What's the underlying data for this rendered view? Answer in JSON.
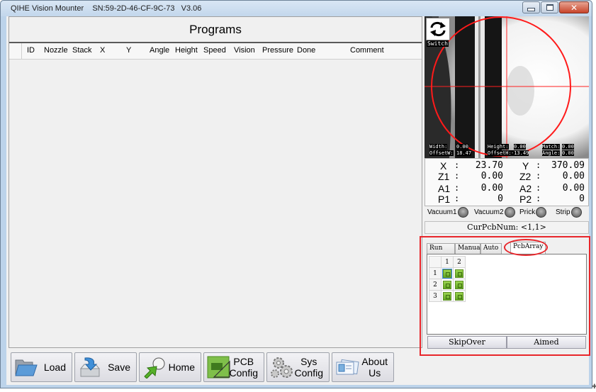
{
  "window": {
    "title": "QIHE Vision Mounter    SN:59-2D-46-CF-9C-73   V3.06",
    "controls": {
      "minimize": "minimize",
      "maximize": "maximize",
      "close": "close"
    }
  },
  "programs": {
    "title": "Programs",
    "columns": [
      "ID",
      "Nozzle",
      "Stack",
      "X",
      "Y",
      "Angle",
      "Height",
      "Speed",
      "Vision",
      "Pressure",
      "Done",
      "Comment"
    ],
    "rows": []
  },
  "camera": {
    "switch_label": "Switch",
    "readouts": {
      "width_label": "Width:",
      "width_value": "0.00",
      "height_label": "Height:",
      "height_value": "0.00",
      "match_label": "Match:",
      "match_value": "0.00",
      "offsetw_label": "OffsetW:",
      "offsetw_value": "18.47",
      "offseth_label": "OffsetH:",
      "offseth_value": "-13.49",
      "angle_label": "Angle:",
      "angle_value": "0.00"
    }
  },
  "coordinates": {
    "x": {
      "label": "X",
      "value": "23.70"
    },
    "y": {
      "label": "Y",
      "value": "370.09"
    },
    "z1": {
      "label": "Z1",
      "value": "0.00"
    },
    "z2": {
      "label": "Z2",
      "value": "0.00"
    },
    "a1": {
      "label": "A1",
      "value": "0.00"
    },
    "a2": {
      "label": "A2",
      "value": "0.00"
    },
    "p1": {
      "label": "P1",
      "value": "0"
    },
    "p2": {
      "label": "P2",
      "value": "0"
    },
    "colon": ":"
  },
  "indicators": [
    {
      "label": "Vacuum1",
      "state": "off"
    },
    {
      "label": "Vacuum2",
      "state": "off"
    },
    {
      "label": "Prick",
      "state": "off"
    },
    {
      "label": "Strip",
      "state": "off"
    }
  ],
  "cur_pcb_num": "CurPcbNum: <1,1>",
  "tabs": {
    "items": [
      "Run",
      "Manual",
      "Auto",
      "PcbArray"
    ],
    "active": "PcbArray"
  },
  "pcb_array": {
    "col_headers": [
      "1",
      "2"
    ],
    "row_headers": [
      "1",
      "2",
      "3"
    ],
    "selected": [
      1,
      1
    ]
  },
  "pcb_buttons": {
    "skip_over": "SkipOver",
    "aimed": "Aimed"
  },
  "toolbar": {
    "load": "Load",
    "save": "Save",
    "home": "Home",
    "pcb_config_1": "PCB",
    "pcb_config_2": "Config",
    "sys_config_1": "Sys",
    "sys_config_2": "Config",
    "about_us_1": "About",
    "about_us_2": "Us"
  },
  "colors": {
    "highlight_red": "#e8262b",
    "crosshair": "#ff2020",
    "led_off": "#7a7a7a"
  }
}
